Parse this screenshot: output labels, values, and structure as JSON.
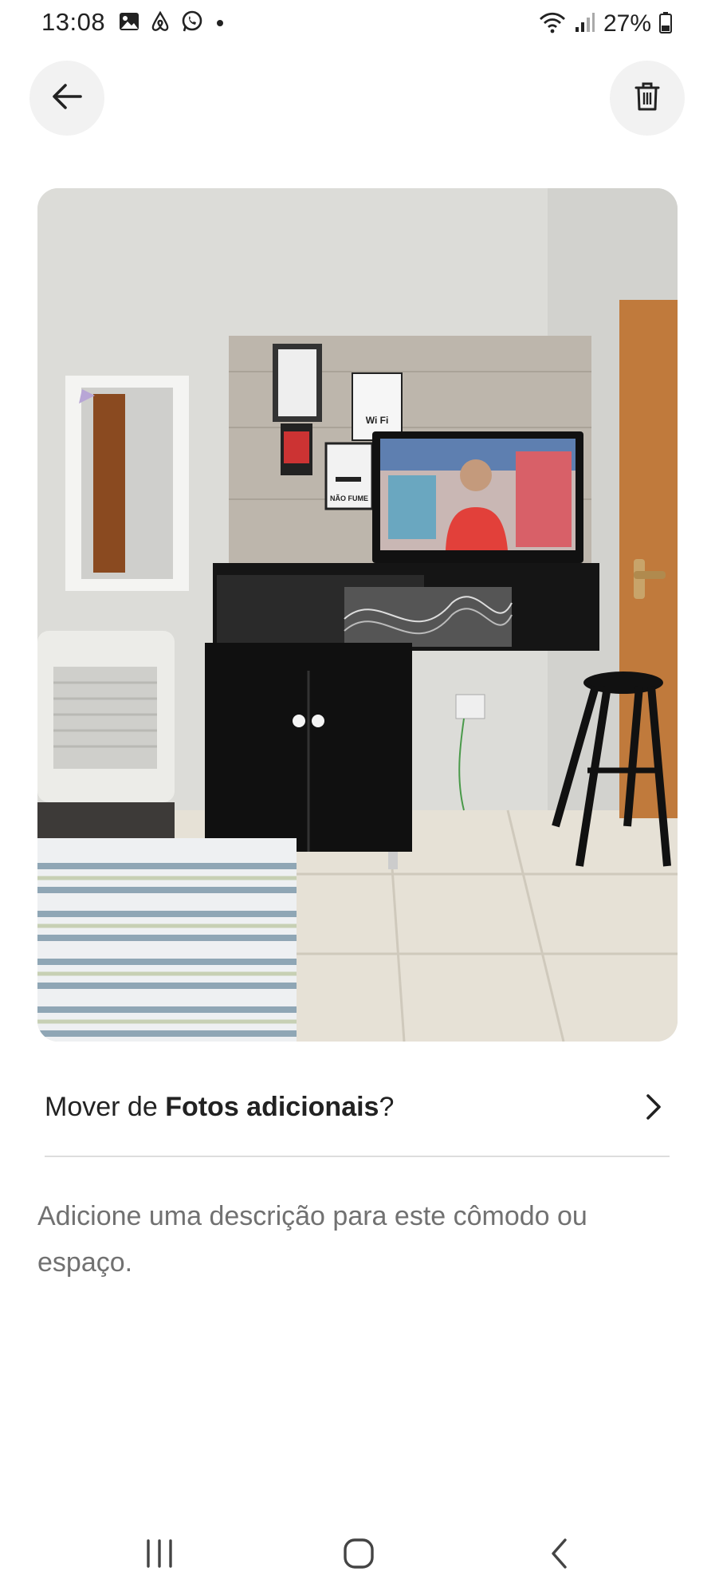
{
  "status_bar": {
    "time": "13:08",
    "battery": "27%",
    "left_icons": [
      "gallery-icon",
      "airbnb-icon",
      "whatsapp-icon",
      "notification-dot"
    ],
    "right_icons": [
      "wifi-icon",
      "signal-icon",
      "battery-icon"
    ]
  },
  "header": {
    "back_icon": "arrow-left-icon",
    "delete_icon": "trash-icon"
  },
  "photo": {
    "sign_wifi": "Wi Fi",
    "sign_no_smoking": "NÃO FUME"
  },
  "move_row": {
    "prefix": "Mover de ",
    "album": "Fotos adicionais",
    "suffix": "?",
    "chevron_icon": "chevron-right-icon"
  },
  "description": {
    "placeholder": "Adicione uma descrição para este cômodo ou espaço."
  },
  "nav_bar": {
    "icons": [
      "recents-icon",
      "home-icon",
      "back-icon"
    ]
  },
  "colors": {
    "text_primary": "#222222",
    "text_secondary": "#717171",
    "button_bg": "#f2f2f2",
    "divider": "#dddddd"
  }
}
